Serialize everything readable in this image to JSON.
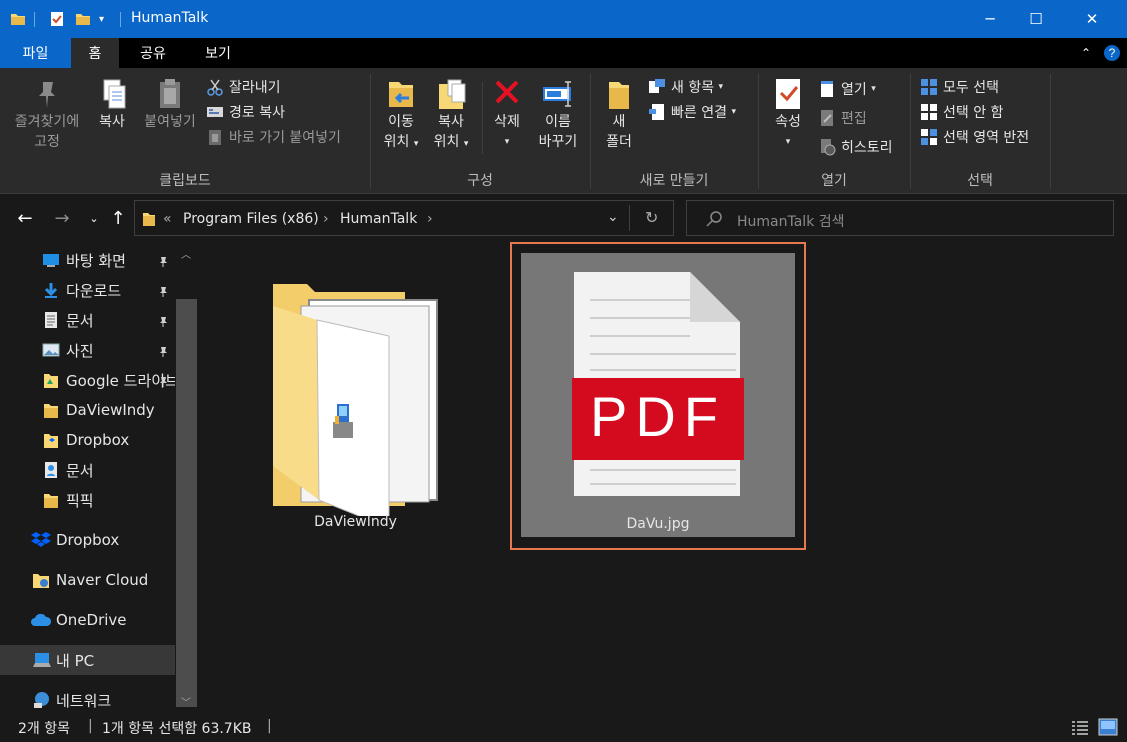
{
  "window": {
    "title": "HumanTalk",
    "controls": {
      "minimize": "─",
      "maximize": "☐",
      "close": "✕"
    }
  },
  "ribbon_tabs": {
    "file": "파일",
    "home": "홈",
    "share": "공유",
    "view": "보기"
  },
  "ribbon": {
    "clipboard": {
      "label": "클립보드",
      "pin_quick_access": [
        "즐겨찾기에",
        "고정"
      ],
      "copy": "복사",
      "paste": "붙여넣기",
      "cut": "잘라내기",
      "copy_path": "경로 복사",
      "paste_shortcut": "바로 가기 붙여넣기"
    },
    "organize": {
      "label": "구성",
      "move_to": [
        "이동",
        "위치"
      ],
      "copy_to": [
        "복사",
        "위치"
      ],
      "delete": "삭제",
      "rename": [
        "이름",
        "바꾸기"
      ]
    },
    "new": {
      "label": "새로 만들기",
      "new_folder": [
        "새",
        "폴더"
      ],
      "new_item": "새 항목",
      "easy_access": "빠른 연결"
    },
    "open": {
      "label": "열기",
      "properties": "속성",
      "open": "열기",
      "edit": "편집",
      "history": "히스토리"
    },
    "select": {
      "label": "선택",
      "select_all": "모두 선택",
      "select_none": "선택 안 함",
      "invert_selection": "선택 영역 반전"
    }
  },
  "address": {
    "overflow": "«",
    "crumbs": [
      "Program Files (x86)",
      "HumanTalk"
    ],
    "separator": "›"
  },
  "search": {
    "placeholder": "HumanTalk 검색"
  },
  "nav_pane": {
    "quick_access": [
      {
        "label": "바탕 화면",
        "pinned": true
      },
      {
        "label": "다운로드",
        "pinned": true
      },
      {
        "label": "문서",
        "pinned": true
      },
      {
        "label": "사진",
        "pinned": true
      },
      {
        "label": "Google 드라이브",
        "pinned": true
      },
      {
        "label": "DaViewIndy",
        "pinned": false
      },
      {
        "label": "Dropbox",
        "pinned": false
      },
      {
        "label": "문서",
        "pinned": false
      },
      {
        "label": "픽픽",
        "pinned": false
      }
    ],
    "roots": [
      {
        "label": "Dropbox"
      },
      {
        "label": "Naver Cloud"
      },
      {
        "label": "OneDrive"
      },
      {
        "label": "내 PC",
        "selected": true
      },
      {
        "label": "네트워크"
      }
    ]
  },
  "files": [
    {
      "name": "DaViewIndy",
      "type": "folder",
      "selected": false
    },
    {
      "name": "DaVu.jpg",
      "type": "image",
      "thumbnail_text": "PDF",
      "selected": true
    }
  ],
  "status": {
    "count": "2개 항목",
    "selection": "1개 항목 선택함 63.7KB",
    "divider": "|"
  },
  "colors": {
    "accent": "#0a67c9",
    "selection_border": "#e57a4f",
    "pdf_red": "#d40b1e",
    "delete_red": "#e81123"
  }
}
